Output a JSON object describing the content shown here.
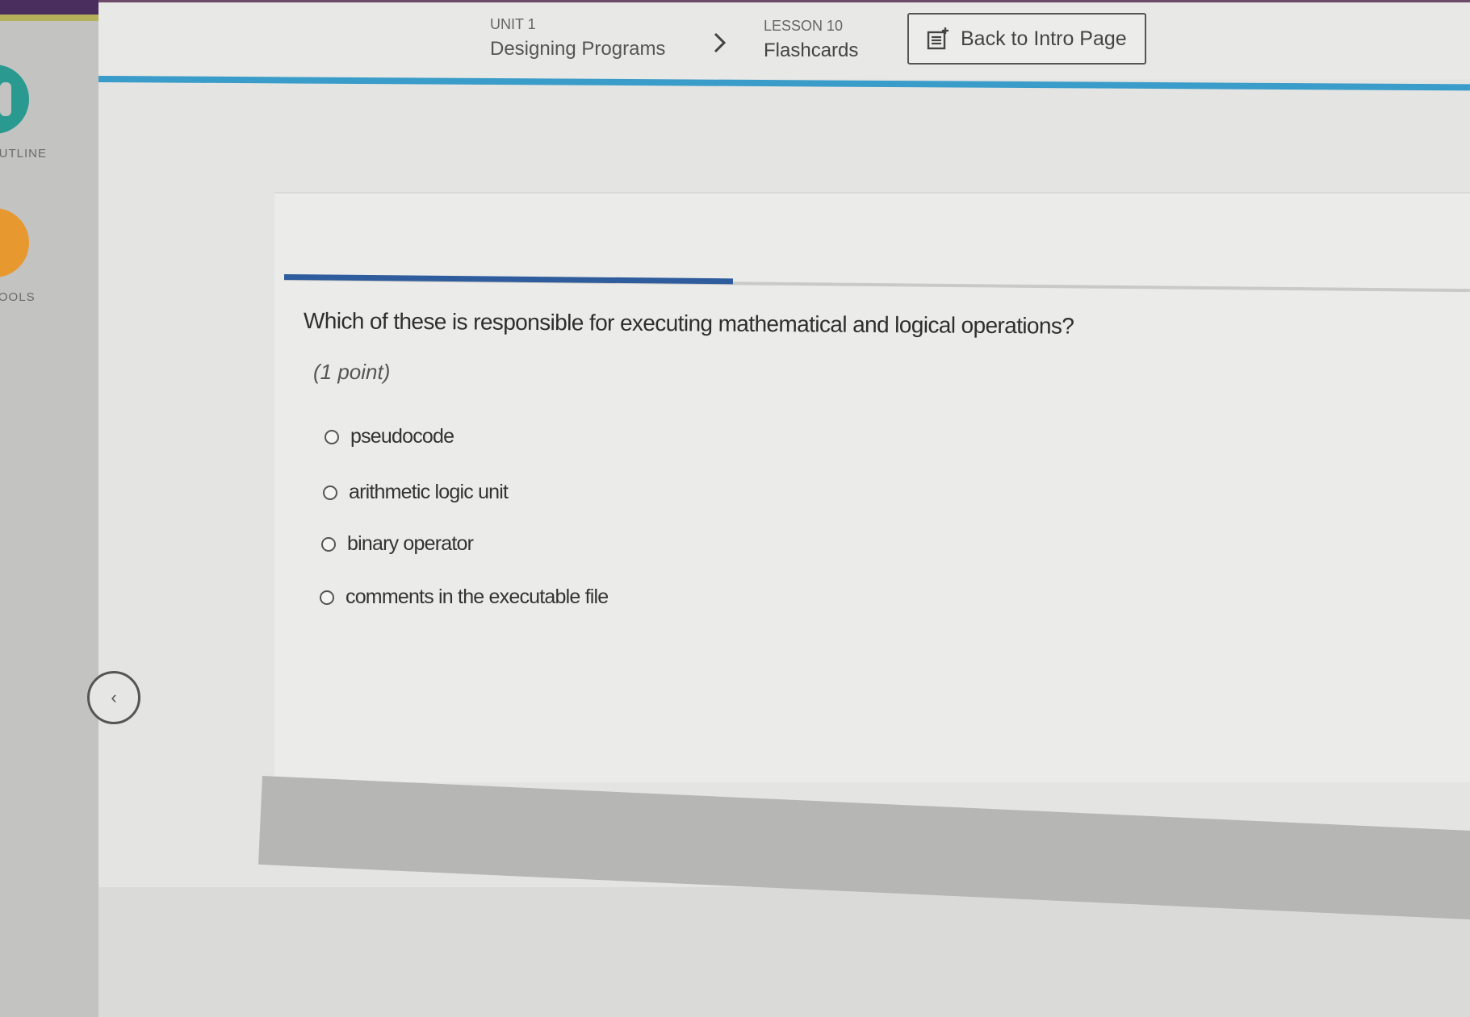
{
  "header": {
    "unit_label": "UNIT 1",
    "unit_title": "Designing Programs",
    "lesson_label": "LESSON 10",
    "lesson_title": "Flashcards",
    "back_button_label": "Back to Intro Page"
  },
  "sidebar": {
    "items": [
      {
        "label": "OUTLINE",
        "icon": "outline-tab-icon",
        "color": "#2a9a91"
      },
      {
        "label": "TOOLS",
        "icon": "tools-tab-icon",
        "color": "#e7982e"
      }
    ]
  },
  "quiz": {
    "question": "Which of these is responsible for executing mathematical and logical operations?",
    "points": "(1 point)",
    "options": [
      "pseudocode",
      "arithmetic logic unit",
      "binary operator",
      "comments in the executable file"
    ],
    "prev_glyph": "‹"
  },
  "colors": {
    "header_progress": "#3a9cc9",
    "question_progress": "#2e5c9c",
    "top_accent": "#4a2f5e"
  }
}
